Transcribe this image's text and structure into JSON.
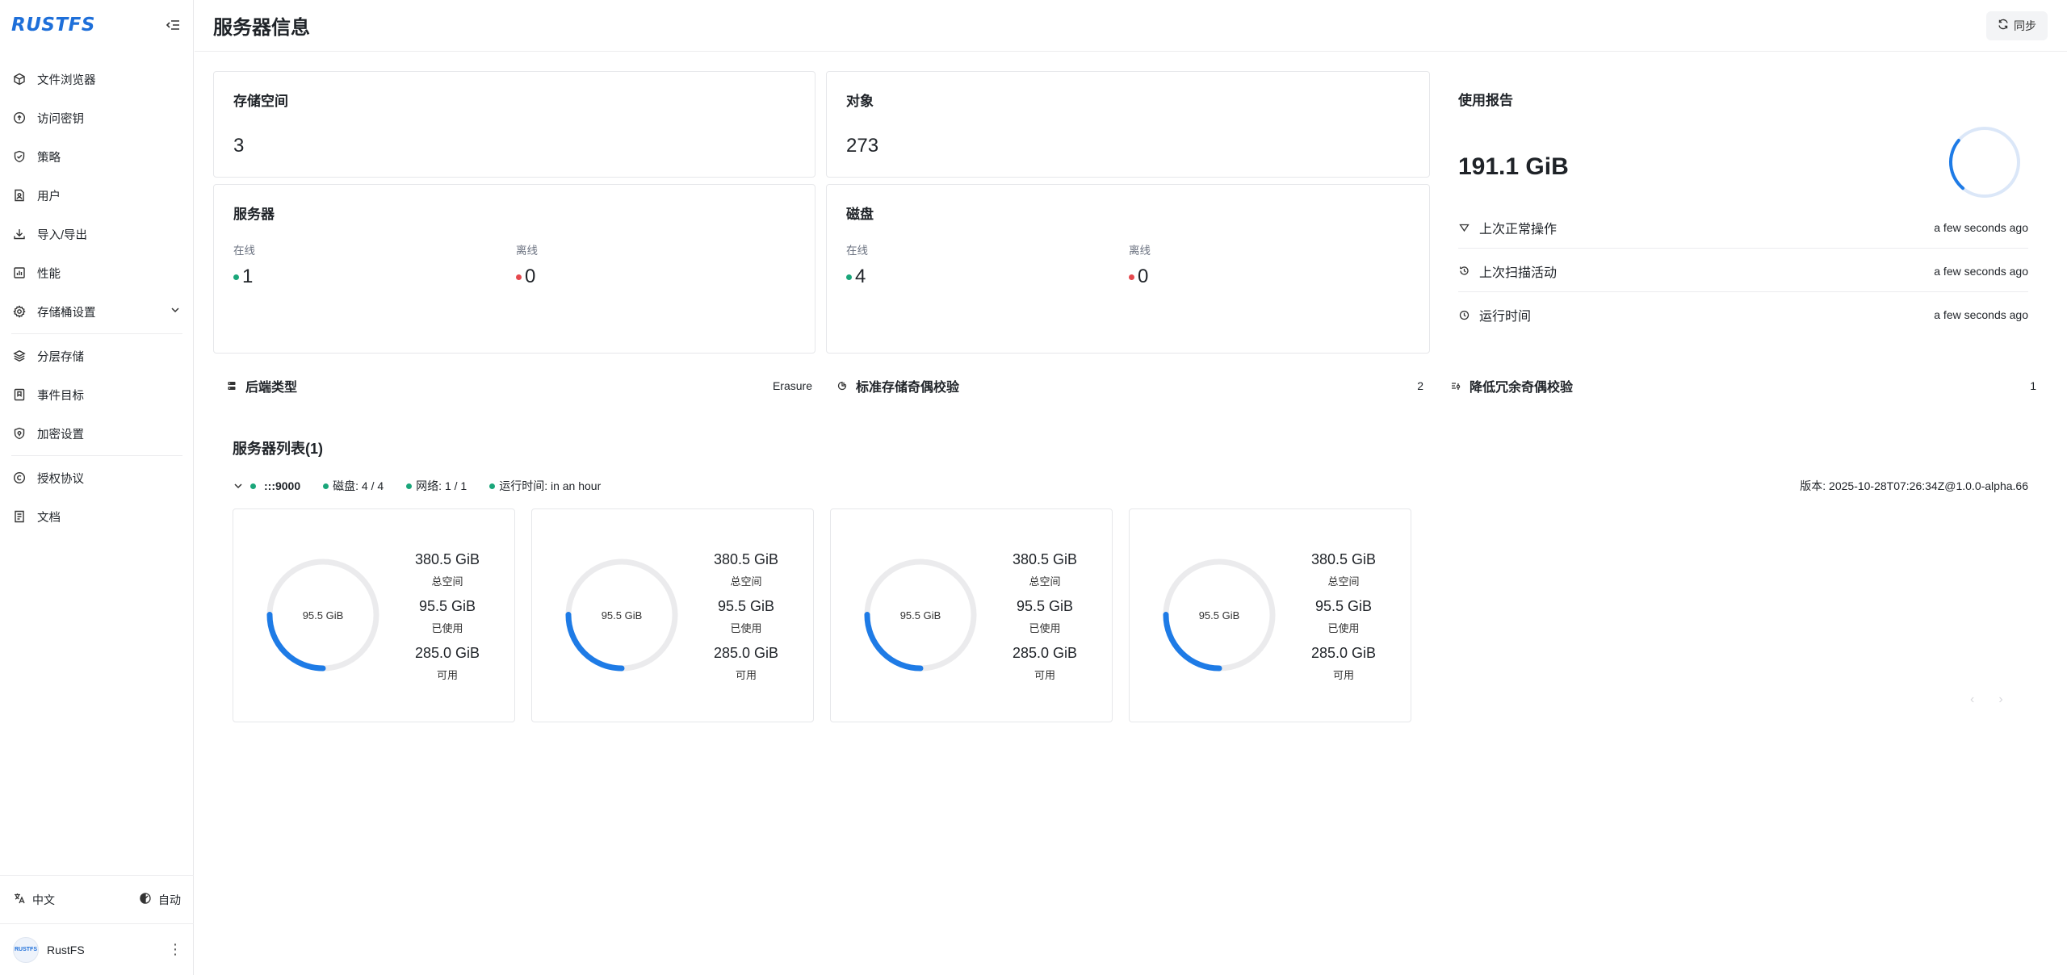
{
  "sidebar": {
    "logo": "RUSTFS",
    "items": [
      {
        "label": "文件浏览器"
      },
      {
        "label": "访问密钥"
      },
      {
        "label": "策略"
      },
      {
        "label": "用户"
      },
      {
        "label": "导入/导出"
      },
      {
        "label": "性能"
      },
      {
        "label": "存储桶设置"
      },
      {
        "label": "分层存储"
      },
      {
        "label": "事件目标"
      },
      {
        "label": "加密设置"
      },
      {
        "label": "授权协议"
      },
      {
        "label": "文档"
      }
    ],
    "language": "中文",
    "theme": "自动",
    "user": {
      "avatar_text": "RUSTFS",
      "name": "RustFS"
    }
  },
  "header": {
    "title": "服务器信息",
    "sync_label": "同步"
  },
  "stats": {
    "buckets": {
      "title": "存储空间",
      "value": "3"
    },
    "objects": {
      "title": "对象",
      "value": "273"
    },
    "servers": {
      "title": "服务器",
      "online_label": "在线",
      "online": "1",
      "offline_label": "离线",
      "offline": "0"
    },
    "disks": {
      "title": "磁盘",
      "online_label": "在线",
      "online": "4",
      "offline_label": "离线",
      "offline": "0"
    }
  },
  "usage": {
    "title": "使用报告",
    "value": "191.1 GiB",
    "rows": [
      {
        "label": "上次正常操作",
        "time": "a few seconds ago"
      },
      {
        "label": "上次扫描活动",
        "time": "a few seconds ago"
      },
      {
        "label": "运行时间",
        "time": "a few seconds ago"
      }
    ]
  },
  "info": {
    "backend_label": "后端类型",
    "backend_value": "Erasure",
    "standard_parity_label": "标准存储奇偶校验",
    "standard_parity_value": "2",
    "rr_parity_label": "降低冗余奇偶校验",
    "rr_parity_value": "1"
  },
  "server_list": {
    "title": "服务器列表(1)",
    "host": ":::9000",
    "disks": "磁盘: 4 / 4",
    "network": "网络: 1 / 1",
    "uptime": "运行时间: in an hour",
    "version": "版本: 2025-10-28T07:26:34Z@1.0.0-alpha.66",
    "disk_cards": [
      {
        "used_center": "95.5 GiB",
        "total": "380.5 GiB",
        "total_label": "总空间",
        "used": "95.5 GiB",
        "used_label": "已使用",
        "free": "285.0 GiB",
        "free_label": "可用",
        "used_fraction": 0.251
      },
      {
        "used_center": "95.5 GiB",
        "total": "380.5 GiB",
        "total_label": "总空间",
        "used": "95.5 GiB",
        "used_label": "已使用",
        "free": "285.0 GiB",
        "free_label": "可用",
        "used_fraction": 0.251
      },
      {
        "used_center": "95.5 GiB",
        "total": "380.5 GiB",
        "total_label": "总空间",
        "used": "95.5 GiB",
        "used_label": "已使用",
        "free": "285.0 GiB",
        "free_label": "可用",
        "used_fraction": 0.251
      },
      {
        "used_center": "95.5 GiB",
        "total": "380.5 GiB",
        "total_label": "总空间",
        "used": "95.5 GiB",
        "used_label": "已使用",
        "free": "285.0 GiB",
        "free_label": "可用",
        "used_fraction": 0.251
      }
    ]
  },
  "colors": {
    "accent": "#1e7be6",
    "ring_track": "#ebebed",
    "online": "#1aa67a",
    "offline": "#e5484d"
  }
}
